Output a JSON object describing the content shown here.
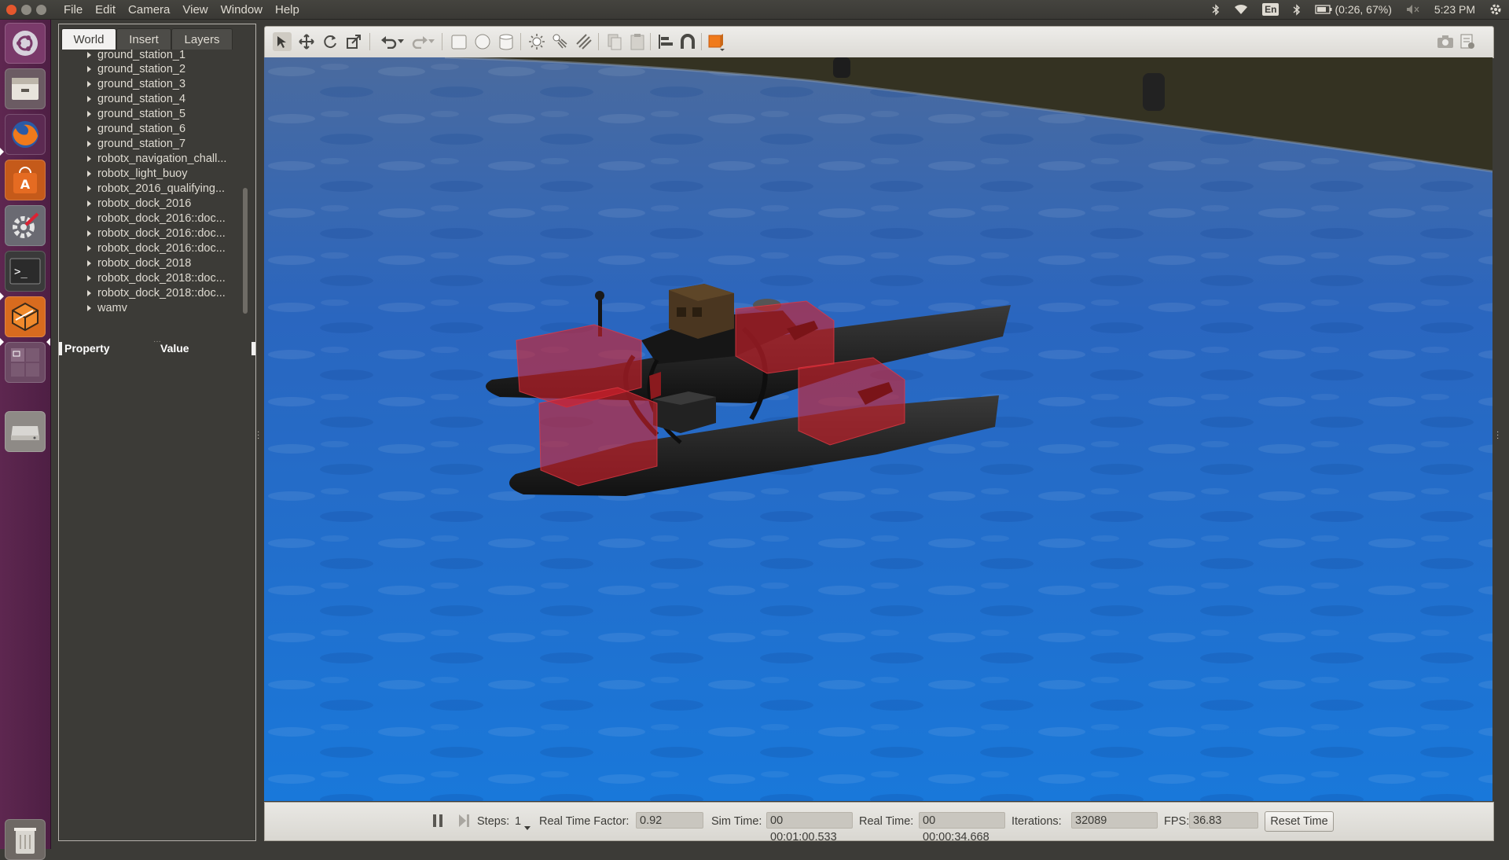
{
  "menu": [
    "File",
    "Edit",
    "Camera",
    "View",
    "Window",
    "Help"
  ],
  "tray": {
    "keyboard": "En",
    "battery": "(0:26, 67%)",
    "clock": "5:23 PM"
  },
  "launcher": {
    "items": [
      "ubuntu-dash-icon",
      "files-icon",
      "firefox-icon",
      "software-center-icon",
      "system-settings-icon",
      "terminal-icon",
      "gazebo-icon",
      "workspace-switcher-icon",
      "drive-icon",
      "trash-icon"
    ]
  },
  "tabs": [
    "World",
    "Insert",
    "Layers"
  ],
  "tree": [
    "ground_station_1",
    "ground_station_2",
    "ground_station_3",
    "ground_station_4",
    "ground_station_5",
    "ground_station_6",
    "ground_station_7",
    "robotx_navigation_chall...",
    "robotx_light_buoy",
    "robotx_2016_qualifying...",
    "robotx_dock_2016",
    "robotx_dock_2016::doc...",
    "robotx_dock_2016::doc...",
    "robotx_dock_2016::doc...",
    "robotx_dock_2018",
    "robotx_dock_2018::doc...",
    "robotx_dock_2018::doc...",
    "wamv"
  ],
  "properties": {
    "col_property": "Property",
    "col_value": "Value"
  },
  "toolbar": {
    "icons": [
      "select-arrow-icon",
      "translate-icon",
      "rotate-icon",
      "scale-icon",
      "undo-icon",
      "undo-history-icon",
      "redo-icon",
      "redo-history-icon",
      "box-icon",
      "sphere-icon",
      "cylinder-icon",
      "point-light-icon",
      "spot-light-icon",
      "directional-light-icon",
      "copy-icon",
      "paste-icon",
      "align-icon",
      "snap-icon",
      "view-angle-icon",
      "screenshot-icon",
      "log-icon"
    ]
  },
  "status": {
    "steps_label": "Steps:",
    "steps_value": "1",
    "rtf_label": "Real Time Factor:",
    "rtf_value": "0.92",
    "sim_time_label": "Sim Time:",
    "sim_time_value": "00 00:01:00.533",
    "real_time_label": "Real Time:",
    "real_time_value": "00 00:00:34.668",
    "iterations_label": "Iterations:",
    "iterations_value": "32089",
    "fps_label": "FPS:",
    "fps_value": "36.83",
    "reset_label": "Reset Time"
  },
  "colors": {
    "launcher": "#5e2750",
    "panel": "#3c3b37",
    "water": "#1e6fd0",
    "collision": "#d2202c"
  }
}
